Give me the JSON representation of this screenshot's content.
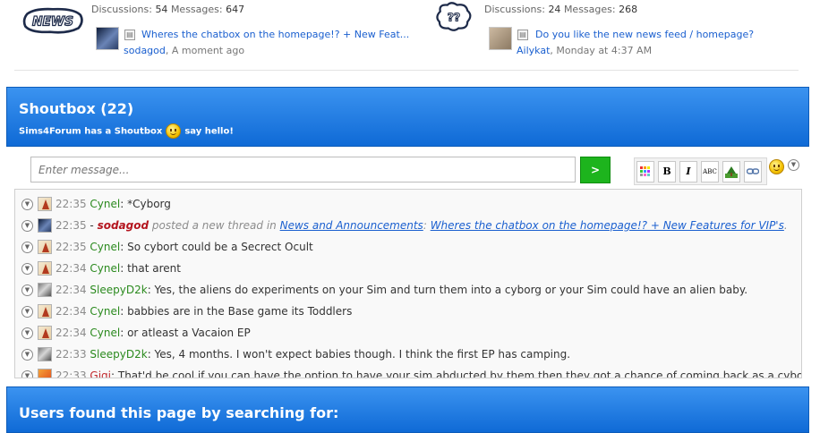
{
  "forums": [
    {
      "logo": "NEWS",
      "stats": {
        "discussions_label": "Discussions:",
        "discussions": "54",
        "messages_label": "Messages:",
        "messages": "647"
      },
      "latest": {
        "title": "Wheres the chatbox on the homepage!? + New Feat...",
        "user": "sodagod",
        "time": "A moment ago"
      }
    },
    {
      "logo": "??",
      "stats": {
        "discussions_label": "Discussions:",
        "discussions": "24",
        "messages_label": "Messages:",
        "messages": "268"
      },
      "latest": {
        "title": "Do you like the new news feed / homepage?",
        "user": "Ailykat",
        "time": "Monday at 4:37 AM"
      }
    }
  ],
  "shoutbox": {
    "title": "Shoutbox (22)",
    "subtitle_before": "Sims4Forum has a Shoutbox",
    "subtitle_after": "say hello!",
    "input_placeholder": "Enter message...",
    "send_label": ">",
    "toolbar": {
      "bold": "B",
      "italic": "I",
      "spell": "ABC"
    }
  },
  "messages": [
    {
      "time": "22:35",
      "user": "Cynel",
      "text": "*Cyborg",
      "avatar": "cynel"
    },
    {
      "time": "22:35",
      "user": "sodagod",
      "avatar": "soda",
      "action": "posted a new thread in",
      "forum": "News and Announcements",
      "sep": ":",
      "thread": "Wheres the chatbox on the homepage!? + New Features for VIP's",
      "end": "."
    },
    {
      "time": "22:35",
      "user": "Cynel",
      "text": "So cybort could be a Secrect Ocult",
      "avatar": "cynel"
    },
    {
      "time": "22:34",
      "user": "Cynel",
      "text": "that arent",
      "avatar": "cynel"
    },
    {
      "time": "22:34",
      "user": "SleepyD2k",
      "text": "Yes, the aliens do experiments on your Sim and turn them into a cyborg or your Sim could have an alien baby.",
      "avatar": "sleepy"
    },
    {
      "time": "22:34",
      "user": "Cynel",
      "text": "babbies are in the Base game its Toddlers",
      "avatar": "cynel"
    },
    {
      "time": "22:34",
      "user": "Cynel",
      "text": "or atleast a Vacaion EP",
      "avatar": "cynel"
    },
    {
      "time": "22:33",
      "user": "SleepyD2k",
      "text": "Yes, 4 months. I won't expect babies though. I think the first EP has camping.",
      "avatar": "sleepy"
    },
    {
      "time": "22:33",
      "user": "Gigi",
      "text": "That'd be cool if you can have the option to have your sim abducted by them then they got a chance of coming back as a cyborg",
      "avatar": "gigi"
    }
  ],
  "search_section": {
    "title": "Users found this page by searching for:"
  }
}
